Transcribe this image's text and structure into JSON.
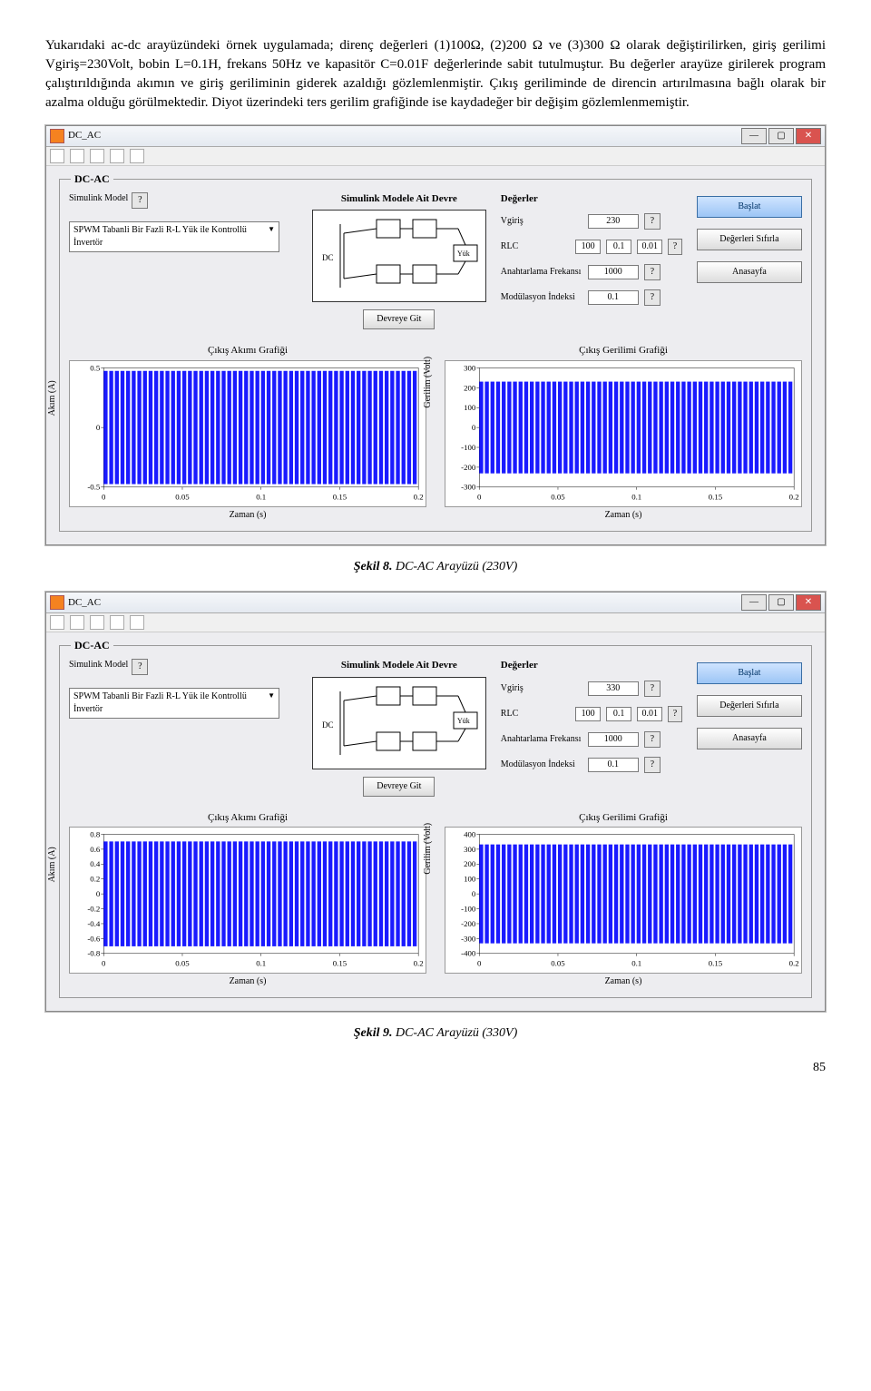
{
  "paragraph": "Yukarıdaki ac-dc arayüzündeki örnek uygulamada; direnç değerleri (1)100Ω, (2)200 Ω ve (3)300 Ω olarak değiştirilirken, giriş gerilimi Vgiriş=230Volt, bobin L=0.1H, frekans 50Hz ve kapasitör C=0.01F değerlerinde sabit tutulmuştur. Bu değerler arayüze girilerek program çalıştırıldığında akımın ve giriş geriliminin giderek azaldığı gözlemlenmiştir. Çıkış geriliminde de direncin artırılmasına bağlı olarak bir azalma olduğu görülmektedir. Diyot üzerindeki ters gerilim grafiğinde ise kaydadeğer bir değişim gözlemlenmemiştir.",
  "window_title": "DC_AC",
  "group_title": "DC-AC",
  "model_label": "Simulink Model",
  "dropdown_value": "SPWM Tabanli Bir Fazli R-L Yük ile Kontrollü İnvertör",
  "circuit_section_title": "Simulink Modele Ait Devre",
  "circuit_dc": "DC",
  "circuit_yuk": "Yük",
  "devreye_git": "Devreye Git",
  "inputs_title": "Değerler",
  "inputs": {
    "vgiris_label": "Vgiriş",
    "rlc_label": "RLC",
    "freq_label": "Anahtarlama Frekansı",
    "mod_label": "Modülasyon İndeksi",
    "rlc_r": "100",
    "rlc_l": "0.1",
    "rlc_c": "0.01",
    "freq_val": "1000",
    "mod_val": "0.1"
  },
  "buttons": {
    "start": "Başlat",
    "reset": "Değerleri Sıfırla",
    "home": "Anasayfa"
  },
  "charts": {
    "akim_title": "Çıkış Akımı Grafiği",
    "gerilim_title": "Çıkış Gerilimi Grafiği",
    "xlabel": "Zaman (s)",
    "ylabel_akim": "Akım (A)",
    "ylabel_gerilim": "Gerilim (Volt)"
  },
  "chart_data": [
    {
      "title": "Şekil 8 — 230V",
      "vgiris": "230",
      "akim": {
        "type": "bar",
        "x_range": [
          0,
          0.2
        ],
        "x_ticks": [
          0,
          0.05,
          0.1,
          0.15,
          0.2
        ],
        "y_range": [
          -0.5,
          0.5
        ],
        "y_ticks": [
          -0.5,
          0,
          0.5
        ],
        "description": "PWM akım çıkışı, yaklaşık ±0.5 A arasında hızlı anahtarlamalı kare darbeler"
      },
      "gerilim": {
        "type": "bar",
        "x_range": [
          0,
          0.2
        ],
        "x_ticks": [
          0,
          0.05,
          0.1,
          0.15,
          0.2
        ],
        "y_range": [
          -300,
          300
        ],
        "y_ticks": [
          -300,
          -200,
          -100,
          0,
          100,
          200,
          300
        ],
        "description": "PWM gerilim çıkışı, yaklaşık ±230 V arasında hızlı anahtarlamalı kare darbeler"
      }
    },
    {
      "title": "Şekil 9 — 330V",
      "vgiris": "330",
      "akim": {
        "type": "bar",
        "x_range": [
          0,
          0.2
        ],
        "x_ticks": [
          0,
          0.05,
          0.1,
          0.15,
          0.2
        ],
        "y_range": [
          -0.8,
          0.8
        ],
        "y_ticks": [
          -0.8,
          -0.6,
          -0.4,
          -0.2,
          0,
          0.2,
          0.4,
          0.6,
          0.8
        ],
        "description": "PWM akım çıkışı, yaklaşık ±0.7 A arasında hızlı anahtarlamalı kare darbeler"
      },
      "gerilim": {
        "type": "bar",
        "x_range": [
          0,
          0.2
        ],
        "x_ticks": [
          0,
          0.05,
          0.1,
          0.15,
          0.2
        ],
        "y_range": [
          -400,
          400
        ],
        "y_ticks": [
          -400,
          -300,
          -200,
          -100,
          0,
          100,
          200,
          300,
          400
        ],
        "description": "PWM gerilim çıkışı, yaklaşık ±330 V arasında hızlı anahtarlamalı kare darbeler"
      }
    }
  ],
  "captions": {
    "fig8_label": "Şekil 8.",
    "fig8_text": " DC-AC Arayüzü (230V)",
    "fig9_label": "Şekil 9.",
    "fig9_text": " DC-AC Arayüzü (330V)"
  },
  "page_number": "85"
}
